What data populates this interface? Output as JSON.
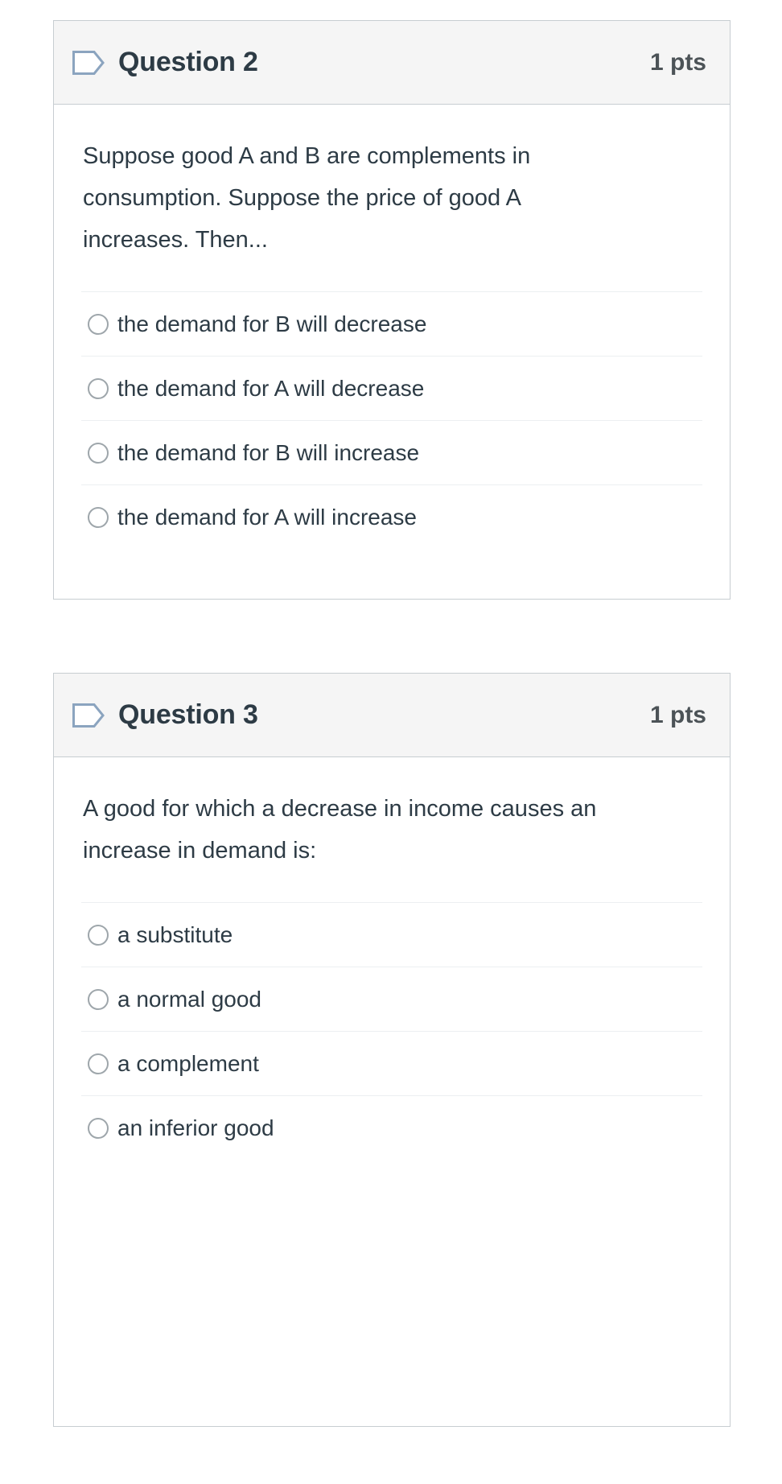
{
  "questions": [
    {
      "icon": "flag-outline-icon",
      "title": "Question 2",
      "points": "1 pts",
      "text": "Suppose good A and B are complements in consumption. Suppose the price of good A increases. Then...",
      "options": [
        "the demand for B will decrease",
        "the demand for A will decrease",
        "the demand for B will increase",
        "the demand for A will increase"
      ]
    },
    {
      "icon": "flag-outline-icon",
      "title": "Question 3",
      "points": "1 pts",
      "text": "A good for which a decrease in income causes an increase in demand is:",
      "options": [
        "a substitute",
        "a normal good",
        "a complement",
        "an inferior good"
      ]
    }
  ],
  "colors": {
    "header_background": "#f5f5f5",
    "card_border": "#c7cdd1",
    "text": "#2d3b45",
    "points_text": "#4c5357",
    "divider": "#eceff1",
    "radio_border": "#9ea6ab",
    "flag_stroke": "#8ba4bf"
  }
}
